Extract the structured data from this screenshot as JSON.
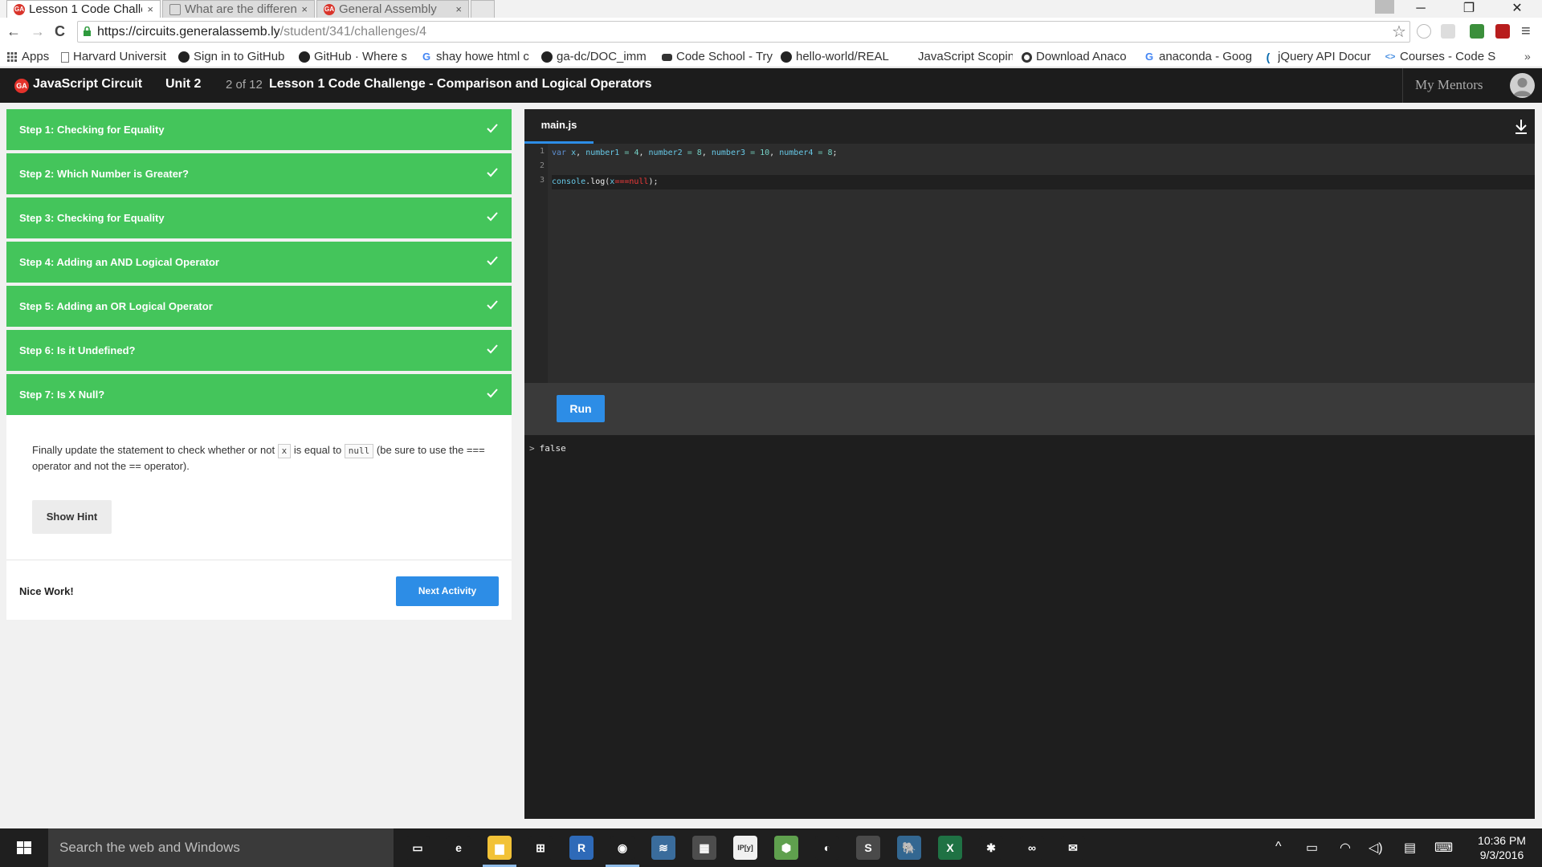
{
  "browser": {
    "tabs": [
      {
        "title": "Lesson 1 Code Challe",
        "favicon": "ga-logo-icon",
        "active": true
      },
      {
        "title": "What are the differen",
        "favicon": "page-icon",
        "active": false
      },
      {
        "title": "General Assembly",
        "favicon": "ga-logo-icon",
        "active": false
      }
    ],
    "close_glyph": "×",
    "window_controls": {
      "minimize": "─",
      "restore": "❐",
      "close": "✕"
    },
    "nav": {
      "back": "←",
      "forward": "→",
      "reload": "C"
    },
    "url": {
      "host": "https://circuits.generalassemb.ly",
      "path": "/student/341/challenges/4"
    },
    "star": "☆",
    "menu": "≡",
    "bookmarks_more": "»",
    "bookmarks": [
      {
        "label": "Apps",
        "icon": "apps-grid-icon"
      },
      {
        "label": "Harvard Universit",
        "icon": "page-icon"
      },
      {
        "label": "Sign in to GitHub",
        "icon": "github-icon"
      },
      {
        "label": "GitHub · Where s",
        "icon": "github-icon"
      },
      {
        "label": "shay howe html c",
        "icon": "google-icon"
      },
      {
        "label": "ga-dc/DOC_imm",
        "icon": "github-icon"
      },
      {
        "label": "Code School - Try",
        "icon": "codeschool-icon"
      },
      {
        "label": "hello-world/REAL",
        "icon": "github-icon"
      },
      {
        "label": "JavaScript Scopin",
        "icon": "none"
      },
      {
        "label": "Download Anaco",
        "icon": "anaconda-icon"
      },
      {
        "label": "anaconda - Goog",
        "icon": "google-icon"
      },
      {
        "label": "jQuery API Docur",
        "icon": "jquery-icon"
      },
      {
        "label": "Courses - Code S",
        "icon": "code-icon"
      }
    ]
  },
  "app_nav": {
    "logo_text": "GA",
    "circuit": "JavaScript Circuit",
    "unit": "Unit 2",
    "progress": "2 of 12",
    "lesson": "Lesson 1 Code Challenge - Comparison and Logical Operators",
    "mentors": "My Mentors"
  },
  "steps": [
    {
      "label": "Step 1: Checking for Equality",
      "completed": true
    },
    {
      "label": "Step 2: Which Number is Greater?",
      "completed": true
    },
    {
      "label": "Step 3: Checking for Equality",
      "completed": true
    },
    {
      "label": "Step 4: Adding an AND Logical Operator",
      "completed": true
    },
    {
      "label": "Step 5: Adding an OR Logical Operator",
      "completed": true
    },
    {
      "label": "Step 6: Is it Undefined?",
      "completed": true
    },
    {
      "label": "Step 7: Is X Null?",
      "completed": true
    }
  ],
  "instructions": {
    "part1": "Finally update the statement to check whether or not ",
    "code1": "x",
    "part2": " is equal to ",
    "code2": "null",
    "part3": " (be sure to use the === operator and not the == operator).",
    "hint_button": "Show Hint"
  },
  "completion": {
    "message": "Nice Work!",
    "next_button": "Next Activity"
  },
  "editor": {
    "filename": "main.js",
    "line_numbers": [
      "1",
      "2",
      "3"
    ],
    "line1": {
      "kw": "var",
      "x": "x",
      "p1": ",",
      "n1name": "number1",
      "eq1": "=",
      "n1": "4",
      "p2": ",",
      "n2name": "number2",
      "eq2": "=",
      "n2": "8",
      "p3": ",",
      "n3name": "number3",
      "eq3": "=",
      "n3": "10",
      "p4": ",",
      "n4name": "number4",
      "eq4": "=",
      "n4": "8",
      "semi": ";"
    },
    "line3": {
      "obj": "console",
      "dot": ".",
      "fn": "log",
      "open": "(",
      "arg_x": "x",
      "arg_op": "===",
      "arg_null": "null",
      "close": ");"
    },
    "run_button": "Run",
    "console_prompt": ">",
    "console_output": "false"
  },
  "taskbar": {
    "search_placeholder": "Search the web and Windows",
    "apps": [
      {
        "name": "task-view",
        "glyph": "▭",
        "color": "#1f1f1f",
        "running": false
      },
      {
        "name": "edge",
        "glyph": "e",
        "color": "#1f1f1f",
        "running": false
      },
      {
        "name": "file-explorer",
        "glyph": "▆",
        "color": "#f2c237",
        "running": true
      },
      {
        "name": "store",
        "glyph": "⊞",
        "color": "#1f1f1f",
        "running": false
      },
      {
        "name": "r-language",
        "glyph": "R",
        "color": "#2e6ab8",
        "running": false
      },
      {
        "name": "chrome",
        "glyph": "◉",
        "color": "#1f1f1f",
        "running": true
      },
      {
        "name": "python",
        "glyph": "≋",
        "color": "#3a6c9c",
        "running": false
      },
      {
        "name": "calculator",
        "glyph": "▦",
        "color": "#4d4d4d",
        "running": false
      },
      {
        "name": "ipython",
        "glyph": "IP[y]",
        "color": "#f1f1f1",
        "running": false
      },
      {
        "name": "node",
        "glyph": "⬢",
        "color": "#5fa04e",
        "running": false
      },
      {
        "name": "anaconda",
        "glyph": "◐",
        "color": "#1f1f1f",
        "running": false
      },
      {
        "name": "sublime",
        "glyph": "S",
        "color": "#4a4a4a",
        "running": false
      },
      {
        "name": "postgresql",
        "glyph": "🐘",
        "color": "#336791",
        "running": false
      },
      {
        "name": "excel",
        "glyph": "X",
        "color": "#1f7244",
        "running": false
      },
      {
        "name": "slack",
        "glyph": "✱",
        "color": "#1f1f1f",
        "running": false
      },
      {
        "name": "infinity",
        "glyph": "∞",
        "color": "#1f1f1f",
        "running": false
      },
      {
        "name": "mail",
        "glyph": "✉",
        "color": "#1f1f1f",
        "running": false
      }
    ],
    "tray": {
      "chevron": "^",
      "battery": "▭",
      "wifi": "◠",
      "volume": "◁)",
      "notification": "▤",
      "keyboard": "⌨"
    },
    "time": "10:36 PM",
    "date": "9/3/2016"
  },
  "colors": {
    "step_green": "#44c55b",
    "accent_blue": "#2d8de6",
    "nav_bg": "#1c1c1c",
    "editor_bg": "#2d2d2d"
  }
}
